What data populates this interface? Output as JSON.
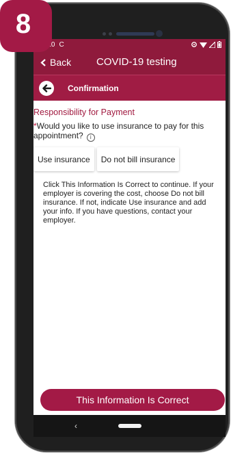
{
  "badge": {
    "number": "8"
  },
  "status_bar": {
    "time": "2:20",
    "sync_glyph": "C"
  },
  "app_bar": {
    "back_label": "Back",
    "title": "COVID-19 testing"
  },
  "sub_header": {
    "title": "Confirmation"
  },
  "section": {
    "title": "Responsibility for Payment",
    "required_mark": "*",
    "question": "Would you like to use insurance to pay for this appointment?",
    "info_glyph": "i"
  },
  "choices": [
    {
      "label": "Use insurance"
    },
    {
      "label": "Do not bill insurance"
    }
  ],
  "help_text": "Click This Information Is Correct to continue. If your employer is covering the cost, choose Do not bill insurance. If not, indicate Use insurance and add your info. If you have questions, contact your employer.",
  "confirm_button": {
    "label": "This Information Is Correct"
  },
  "nav": {
    "back_glyph": "‹"
  },
  "colors": {
    "brand": "#8f1a3c",
    "accent": "#a31a46",
    "section_title": "#a0193f"
  },
  "icons": [
    "chevron-left-icon",
    "circle-back-arrow-icon",
    "info-icon",
    "wifi-icon",
    "battery-icon",
    "signal-icon"
  ]
}
